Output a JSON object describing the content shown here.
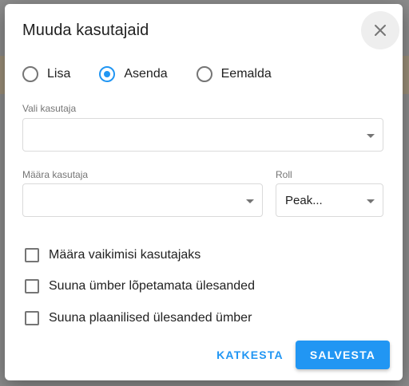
{
  "dialog": {
    "title": "Muuda kasutajaid",
    "close_icon": "close-icon"
  },
  "mode": {
    "options": [
      {
        "label": "Lisa",
        "checked": false
      },
      {
        "label": "Asenda",
        "checked": true
      },
      {
        "label": "Eemalda",
        "checked": false
      }
    ]
  },
  "select_user": {
    "label": "Vali kasutaja",
    "value": ""
  },
  "assign_user": {
    "label": "Määra kasutaja",
    "value": ""
  },
  "role": {
    "label": "Roll",
    "value": "Peak..."
  },
  "checkboxes": [
    {
      "label": "Määra vaikimisi kasutajaks",
      "checked": false
    },
    {
      "label": "Suuna ümber lõpetamata ülesanded",
      "checked": false
    },
    {
      "label": "Suuna plaanilised ülesanded ümber",
      "checked": false
    }
  ],
  "actions": {
    "cancel_label": "KATKESTA",
    "save_label": "SALVESTA"
  },
  "colors": {
    "accent": "#2196f3",
    "backdrop": "#9a9a9a"
  }
}
